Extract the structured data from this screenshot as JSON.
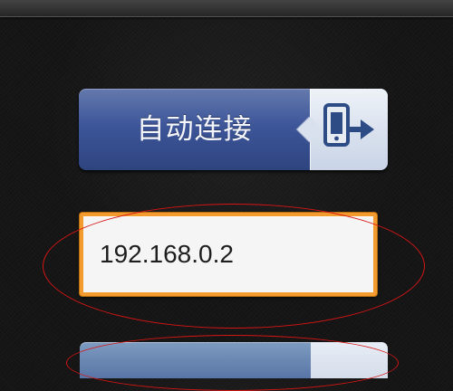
{
  "auto_connect_button": {
    "label": "自动连接",
    "icon": "phone-arrow-icon"
  },
  "ip_address_field": {
    "value": "192.168.0.2"
  },
  "colors": {
    "button_blue": "#3d5699",
    "field_border": "#f39b2e",
    "annotation_red": "#d61515",
    "background": "#151515"
  }
}
